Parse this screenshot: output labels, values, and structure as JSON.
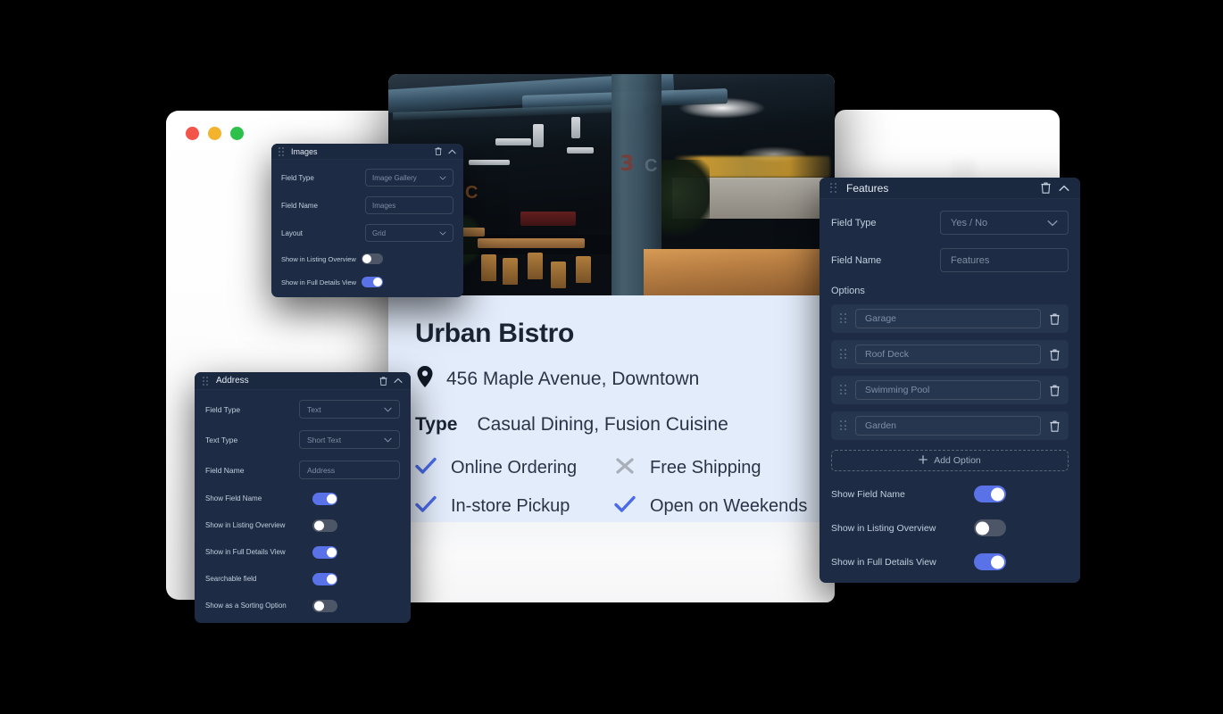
{
  "window": {
    "traffic_lights": [
      "close",
      "minimize",
      "maximize"
    ]
  },
  "listing": {
    "title": "Urban Bistro",
    "address_icon": "location-pin-icon",
    "address": "456 Maple Avenue, Downtown",
    "type_label": "Type",
    "type_value": "Casual Dining, Fusion Cuisine",
    "features": [
      {
        "label": "Online Ordering",
        "state": "yes",
        "icon": "check-icon"
      },
      {
        "label": "Free Shipping",
        "state": "no",
        "icon": "cross-icon"
      },
      {
        "label": "In-store Pickup",
        "state": "yes",
        "icon": "check-icon"
      },
      {
        "label": "Open on Weekends",
        "state": "yes",
        "icon": "check-icon"
      }
    ]
  },
  "panels": {
    "images": {
      "title": "Images",
      "delete_icon": "trash-icon",
      "collapse_icon": "chevron-up-icon",
      "fields": [
        {
          "label": "Field Type",
          "value": "Image Gallery",
          "control": "select"
        },
        {
          "label": "Field Name",
          "value": "Images",
          "control": "input"
        },
        {
          "label": "Layout",
          "value": "Grid",
          "control": "select"
        }
      ],
      "toggles": [
        {
          "label": "Show in Listing Overview",
          "state": "off"
        },
        {
          "label": "Show in Full Details View",
          "state": "on"
        }
      ]
    },
    "address": {
      "title": "Address",
      "delete_icon": "trash-icon",
      "collapse_icon": "chevron-up-icon",
      "fields": [
        {
          "label": "Field Type",
          "value": "Text",
          "control": "select"
        },
        {
          "label": "Text Type",
          "value": "Short Text",
          "control": "select"
        },
        {
          "label": "Field Name",
          "value": "Address",
          "control": "input"
        }
      ],
      "toggles": [
        {
          "label": "Show Field Name",
          "state": "on"
        },
        {
          "label": "Show in Listing Overview",
          "state": "off"
        },
        {
          "label": "Show in Full Details View",
          "state": "on"
        },
        {
          "label": "Searchable field",
          "state": "on"
        },
        {
          "label": "Show as a Sorting Option",
          "state": "off"
        }
      ]
    },
    "features": {
      "title": "Features",
      "delete_icon": "trash-icon",
      "collapse_icon": "chevron-up-icon",
      "fields": [
        {
          "label": "Field Type",
          "value": "Yes / No",
          "control": "select"
        },
        {
          "label": "Field Name",
          "value": "Features",
          "control": "input"
        }
      ],
      "options_label": "Options",
      "options": [
        {
          "value": "Garage",
          "drag_icon": "drag-handle-icon",
          "delete_icon": "trash-icon"
        },
        {
          "value": "Roof Deck",
          "drag_icon": "drag-handle-icon",
          "delete_icon": "trash-icon"
        },
        {
          "value": "Swimming Pool",
          "drag_icon": "drag-handle-icon",
          "delete_icon": "trash-icon"
        },
        {
          "value": "Garden",
          "drag_icon": "drag-handle-icon",
          "delete_icon": "trash-icon"
        }
      ],
      "add_option_label": "Add Option",
      "add_option_icon": "plus-icon",
      "toggles": [
        {
          "label": "Show Field Name",
          "state": "on"
        },
        {
          "label": "Show in Listing Overview",
          "state": "off"
        },
        {
          "label": "Show in Full Details View",
          "state": "on"
        }
      ]
    }
  },
  "colors": {
    "panel_bg": "#1d2c44",
    "panel_head": "#1a2840",
    "accent": "#5a72e8",
    "toggle_off": "#4d5666",
    "card_info_bg": "#e3ecfb",
    "heading": "#1b2434"
  }
}
